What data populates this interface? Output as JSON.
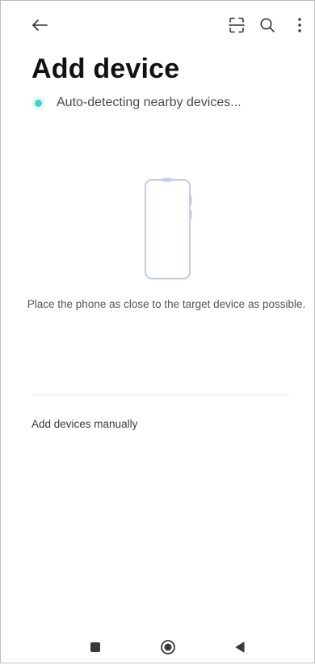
{
  "header": {
    "title": "Add device",
    "status": "Auto-detecting nearby devices...",
    "icons": {
      "back": "arrow-left-icon",
      "scan": "scan-icon",
      "search": "search-icon",
      "more": "more-vertical-icon"
    }
  },
  "main": {
    "illustration": "phone-outline-icon",
    "instruction": "Place the phone as close to the target device as possible.",
    "manual_link": "Add devices manually"
  },
  "nav": {
    "icons": [
      "square-icon",
      "circle-icon",
      "triangle-back-icon"
    ]
  },
  "colors": {
    "accent": "#4fd1c5",
    "illustration_stroke": "#c5cbe0",
    "illustration_accent": "#c9dcf2"
  }
}
